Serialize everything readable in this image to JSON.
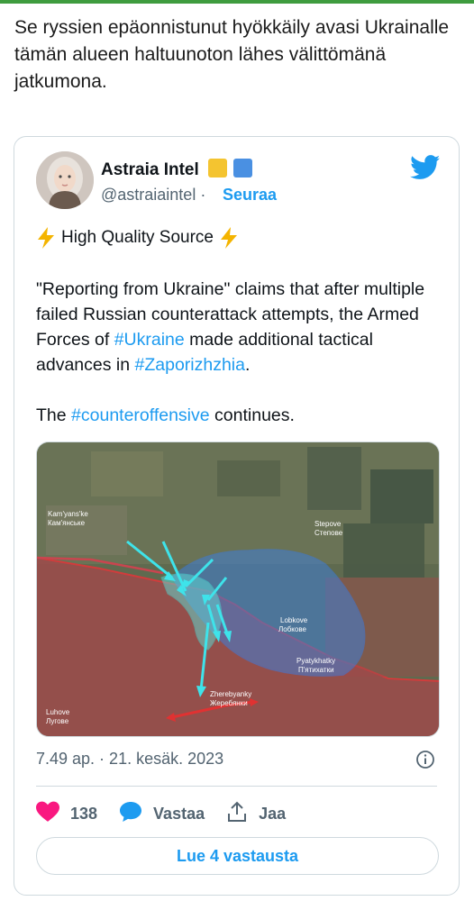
{
  "article": {
    "intro_text": "Se ryssien epäonnistunut hyökkäily avasi Ukrainalle tämän alueen haltuunoton lähes välittömänä jatkumona."
  },
  "tweet": {
    "author_name": "Astraia Intel",
    "author_handle": "@astraiaintel",
    "separator": "·",
    "follow_label": "Seuraa",
    "badge_colors": [
      "#f4c430",
      "#4a90e2"
    ],
    "headline": "High Quality Source",
    "text_1a": "\"Reporting from Ukraine\" claims that after multiple failed Russian counterattack attempts, the Armed Forces of ",
    "hashtag_ukraine": "#Ukraine",
    "text_1b": " made additional tactical advances in ",
    "hashtag_zaporizhzhia": "#Zaporizhzhia",
    "text_1c": ".",
    "text_2a": "The ",
    "hashtag_counteroffensive": "#counteroffensive",
    "text_2b": " continues.",
    "timestamp": "7.49 ap. · 21. kesäk. 2023",
    "likes_count": "138",
    "reply_label": "Vastaa",
    "share_label": "Jaa",
    "read_replies_label": "Lue 4 vastausta",
    "accent_color": "#1d9bf0",
    "like_color": "#f91880"
  },
  "map_labels": {
    "kamyanske": "Kam'yans'ke",
    "kamyanske_cyr": "Кам'янське",
    "stepove": "Stepove",
    "stepove_cyr": "Степове",
    "lobkove": "Lobkove",
    "lobkove_cyr": "Лобкове",
    "pyatykhatky": "Pyatykhatky",
    "pyatykhatky_cyr": "П'ятихатки",
    "zherebyanky": "Zherebyanky",
    "zherebyanky_cyr": "Жеребянки",
    "luhove": "Luhove",
    "luhove_cyr": "Лугове"
  },
  "icons": [
    "twitter-bird-icon",
    "lightning-icon",
    "info-icon",
    "heart-icon",
    "reply-bubble-icon",
    "share-icon"
  ]
}
